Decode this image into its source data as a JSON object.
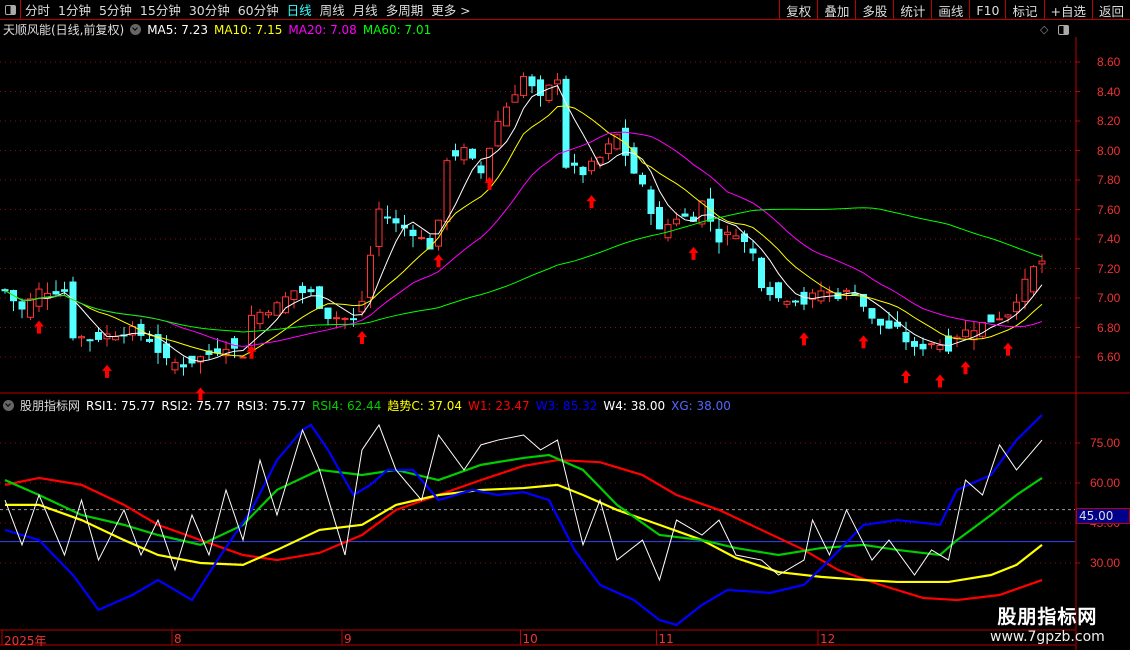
{
  "toolbar": {
    "periods": [
      "分时",
      "1分钟",
      "5分钟",
      "15分钟",
      "30分钟",
      "60分钟",
      "日线",
      "周线",
      "月线",
      "多周期",
      "更多 >"
    ],
    "active": "日线",
    "tools": [
      "复权",
      "叠加",
      "多股",
      "统计",
      "画线",
      "F10",
      "标记",
      "+自选",
      "返回"
    ]
  },
  "main": {
    "title": "天顺风能(日线,前复权)",
    "ma5": "MA5: 7.23",
    "ma10": "MA10: 7.15",
    "ma20": "MA20: 7.08",
    "ma60": "MA60: 7.01"
  },
  "indicator": {
    "title": "股朋指标网",
    "rsi1": "RSI1: 75.77",
    "rsi2": "RSI2: 75.77",
    "rsi3": "RSI3: 75.77",
    "rsi4": "RSI4: 62.44",
    "trend": "趋势C: 37.04",
    "w1": "W1: 23.47",
    "w3": "W3: 85.32",
    "w4": "W4: 38.00",
    "xg": "XG: 38.00",
    "marker": "45.00"
  },
  "colors": {
    "up": "#ff3333",
    "down": "#54ffff",
    "ma5": "#ffffff",
    "ma10": "#ffff00",
    "ma20": "#ff00ff",
    "ma60": "#00ff00",
    "w1": "#ff0000",
    "trend": "#ffff00",
    "rsi4": "#00cc00",
    "w3": "#0000ff",
    "rsi1": "#ffffff",
    "xg": "#3344ff"
  },
  "watermark": {
    "name": "股朋指标网",
    "url": "www.7gpzb.com"
  },
  "chart_data": [
    {
      "type": "candlestick",
      "title": "天顺风能(日线,前复权)",
      "ylim": [
        6.45,
        8.78
      ],
      "yticks": [
        "8.60",
        "8.40",
        "8.20",
        "8.00",
        "7.80",
        "7.60",
        "7.40",
        "7.20",
        "7.00",
        "6.80",
        "6.60"
      ],
      "x_labels": [
        {
          "bar": 0,
          "label": "2025年"
        },
        {
          "bar": 20,
          "label": "8"
        },
        {
          "bar": 40,
          "label": "9"
        },
        {
          "bar": 61,
          "label": "10"
        },
        {
          "bar": 77,
          "label": "11"
        },
        {
          "bar": 96,
          "label": "12"
        }
      ],
      "bars": 123,
      "close_keypoints": [
        [
          0,
          7.05
        ],
        [
          2,
          6.92
        ],
        [
          4,
          7.05
        ],
        [
          7,
          7.05
        ],
        [
          8,
          6.75
        ],
        [
          10,
          6.72
        ],
        [
          12,
          6.75
        ],
        [
          15,
          6.78
        ],
        [
          17,
          6.72
        ],
        [
          19,
          6.57
        ],
        [
          21,
          6.55
        ],
        [
          24,
          6.62
        ],
        [
          26,
          6.68
        ],
        [
          28,
          6.62
        ],
        [
          29,
          6.88
        ],
        [
          32,
          6.95
        ],
        [
          34,
          7.05
        ],
        [
          36,
          7.03
        ],
        [
          38,
          6.88
        ],
        [
          41,
          6.85
        ],
        [
          42,
          6.98
        ],
        [
          44,
          7.6
        ],
        [
          46,
          7.5
        ],
        [
          48,
          7.45
        ],
        [
          50,
          7.35
        ],
        [
          51,
          7.5
        ],
        [
          52,
          7.95
        ],
        [
          54,
          8.0
        ],
        [
          56,
          7.85
        ],
        [
          58,
          8.2
        ],
        [
          59,
          8.3
        ],
        [
          61,
          8.5
        ],
        [
          63,
          8.35
        ],
        [
          65,
          8.5
        ],
        [
          66,
          7.9
        ],
        [
          68,
          7.85
        ],
        [
          70,
          7.95
        ],
        [
          72,
          8.1
        ],
        [
          74,
          7.85
        ],
        [
          75,
          7.75
        ],
        [
          77,
          7.45
        ],
        [
          79,
          7.55
        ],
        [
          81,
          7.55
        ],
        [
          82,
          7.65
        ],
        [
          84,
          7.4
        ],
        [
          86,
          7.45
        ],
        [
          88,
          7.3
        ],
        [
          89,
          7.1
        ],
        [
          91,
          7.0
        ],
        [
          93,
          7.0
        ],
        [
          94,
          6.97
        ],
        [
          96,
          7.05
        ],
        [
          98,
          7.02
        ],
        [
          100,
          7.05
        ],
        [
          102,
          6.85
        ],
        [
          103,
          6.82
        ],
        [
          105,
          6.78
        ],
        [
          107,
          6.65
        ],
        [
          109,
          6.7
        ],
        [
          111,
          6.67
        ],
        [
          112,
          6.75
        ],
        [
          114,
          6.8
        ],
        [
          116,
          6.85
        ],
        [
          118,
          6.9
        ],
        [
          119,
          7.0
        ],
        [
          121,
          7.2
        ],
        [
          122,
          7.25
        ]
      ],
      "signal_arrows": [
        4,
        12,
        23,
        29,
        42,
        51,
        57,
        69,
        81,
        94,
        101,
        106,
        110,
        113,
        118
      ],
      "moving_averages": [
        5,
        10,
        20,
        60
      ]
    },
    {
      "type": "line",
      "title": "股朋指标网",
      "ylim": [
        5,
        91
      ],
      "yticks": [
        "75.00",
        "60.00",
        "45.00",
        "30.00"
      ],
      "ref_lines": [
        50,
        38
      ],
      "series": [
        {
          "name": "W1",
          "color": "#ff0000",
          "points": [
            [
              0,
              59.3
            ],
            [
              4,
              61.9
            ],
            [
              9,
              59.3
            ],
            [
              14,
              51.8
            ],
            [
              18,
              44.3
            ],
            [
              23,
              38.6
            ],
            [
              28,
              33
            ],
            [
              32,
              31.1
            ],
            [
              37,
              33.8
            ],
            [
              42,
              40.5
            ],
            [
              46,
              49.9
            ],
            [
              51,
              55.5
            ],
            [
              56,
              61.1
            ],
            [
              61,
              66.4
            ],
            [
              65,
              68.6
            ],
            [
              70,
              67.8
            ],
            [
              75,
              63
            ],
            [
              79,
              55.5
            ],
            [
              84,
              49.9
            ],
            [
              89,
              42.4
            ],
            [
              94,
              34.9
            ],
            [
              98,
              27.4
            ],
            [
              103,
              21.8
            ],
            [
              108,
              16.9
            ],
            [
              112,
              16.1
            ],
            [
              117,
              18
            ],
            [
              122,
              23.6
            ]
          ]
        },
        {
          "name": "趋势C",
          "color": "#ffff00",
          "points": [
            [
              0,
              51.8
            ],
            [
              4,
              51.8
            ],
            [
              9,
              46.1
            ],
            [
              14,
              38.6
            ],
            [
              18,
              33
            ],
            [
              23,
              30
            ],
            [
              28,
              29.3
            ],
            [
              32,
              34.9
            ],
            [
              37,
              42.4
            ],
            [
              42,
              44.3
            ],
            [
              46,
              51.8
            ],
            [
              51,
              55.5
            ],
            [
              56,
              57.4
            ],
            [
              61,
              58.1
            ],
            [
              65,
              59.3
            ],
            [
              68,
              55.5
            ],
            [
              72,
              49.9
            ],
            [
              77,
              44.3
            ],
            [
              82,
              38.6
            ],
            [
              86,
              31.9
            ],
            [
              91,
              26.6
            ],
            [
              96,
              24.8
            ],
            [
              101,
              23.6
            ],
            [
              105,
              22.9
            ],
            [
              111,
              22.9
            ],
            [
              116,
              25.5
            ],
            [
              119,
              29.3
            ],
            [
              122,
              36.8
            ]
          ]
        },
        {
          "name": "RSI4",
          "color": "#00cc00",
          "points": [
            [
              0,
              61.1
            ],
            [
              4,
              55.5
            ],
            [
              9,
              48
            ],
            [
              14,
              44.3
            ],
            [
              18,
              40.5
            ],
            [
              23,
              36.8
            ],
            [
              28,
              44.3
            ],
            [
              32,
              57.4
            ],
            [
              37,
              64.9
            ],
            [
              42,
              63
            ],
            [
              46,
              64.9
            ],
            [
              51,
              61.1
            ],
            [
              56,
              66.8
            ],
            [
              61,
              69.4
            ],
            [
              64,
              70.5
            ],
            [
              68,
              64.9
            ],
            [
              72,
              51.8
            ],
            [
              77,
              40.5
            ],
            [
              82,
              38.6
            ],
            [
              86,
              35.6
            ],
            [
              91,
              33
            ],
            [
              96,
              35.6
            ],
            [
              101,
              36.8
            ],
            [
              105,
              34.9
            ],
            [
              110,
              33
            ],
            [
              112,
              38.6
            ],
            [
              116,
              48
            ],
            [
              119,
              55.5
            ],
            [
              122,
              61.9
            ]
          ]
        },
        {
          "name": "W3",
          "color": "#0000ff",
          "points": [
            [
              0,
              42.4
            ],
            [
              4,
              38.6
            ],
            [
              8,
              25.5
            ],
            [
              11,
              12.4
            ],
            [
              15,
              18
            ],
            [
              18,
              23.6
            ],
            [
              22,
              16.1
            ],
            [
              25,
              31.1
            ],
            [
              29,
              49.9
            ],
            [
              32,
              68.6
            ],
            [
              35,
              79.9
            ],
            [
              36,
              81.75
            ],
            [
              38,
              72.4
            ],
            [
              41,
              55.5
            ],
            [
              43,
              59.3
            ],
            [
              45,
              64.9
            ],
            [
              48,
              64.9
            ],
            [
              51,
              53.6
            ],
            [
              55,
              57.4
            ],
            [
              58,
              55.5
            ],
            [
              61,
              56.6
            ],
            [
              64,
              53.6
            ],
            [
              67,
              34.9
            ],
            [
              70,
              21.8
            ],
            [
              74,
              16.1
            ],
            [
              77,
              8.6
            ],
            [
              79,
              6.8
            ],
            [
              82,
              14.3
            ],
            [
              85,
              19.9
            ],
            [
              90,
              18.8
            ],
            [
              94,
              21.8
            ],
            [
              97,
              31.1
            ],
            [
              101,
              44.3
            ],
            [
              105,
              46.1
            ],
            [
              110,
              44.3
            ],
            [
              112,
              57.4
            ],
            [
              116,
              63
            ],
            [
              119,
              76.1
            ],
            [
              122,
              85.5
            ]
          ]
        },
        {
          "name": "RSI1",
          "color": "#ffffff",
          "points": [
            [
              0,
              53.6
            ],
            [
              2,
              36.8
            ],
            [
              4,
              55.5
            ],
            [
              7,
              33
            ],
            [
              9,
              53.6
            ],
            [
              11,
              31.1
            ],
            [
              14,
              49.9
            ],
            [
              16,
              33
            ],
            [
              18,
              46.1
            ],
            [
              20,
              27.4
            ],
            [
              22,
              48
            ],
            [
              24,
              33
            ],
            [
              26,
              57.4
            ],
            [
              28,
              38.6
            ],
            [
              30,
              68.6
            ],
            [
              32,
              48
            ],
            [
              35,
              79.9
            ],
            [
              37,
              64.9
            ],
            [
              40,
              33
            ],
            [
              42,
              72.4
            ],
            [
              44,
              81.75
            ],
            [
              46,
              64.9
            ],
            [
              49,
              53.6
            ],
            [
              51,
              78
            ],
            [
              54,
              64.9
            ],
            [
              56,
              74.3
            ],
            [
              58,
              76.1
            ],
            [
              61,
              78
            ],
            [
              63,
              72.4
            ],
            [
              65,
              76.1
            ],
            [
              68,
              36.8
            ],
            [
              70,
              53.6
            ],
            [
              72,
              31.1
            ],
            [
              75,
              38.6
            ],
            [
              77,
              23.6
            ],
            [
              79,
              46.1
            ],
            [
              82,
              40.5
            ],
            [
              84,
              46.1
            ],
            [
              86,
              33
            ],
            [
              89,
              31.1
            ],
            [
              91,
              25.5
            ],
            [
              94,
              31.1
            ],
            [
              95,
              46.1
            ],
            [
              97,
              33
            ],
            [
              99,
              49.9
            ],
            [
              102,
              31.1
            ],
            [
              104,
              38.6
            ],
            [
              107,
              25.5
            ],
            [
              109,
              34.9
            ],
            [
              111,
              31.1
            ],
            [
              113,
              61.1
            ],
            [
              115,
              55.5
            ],
            [
              117,
              74.3
            ],
            [
              119,
              64.9
            ],
            [
              122,
              76.1
            ]
          ]
        }
      ]
    }
  ]
}
